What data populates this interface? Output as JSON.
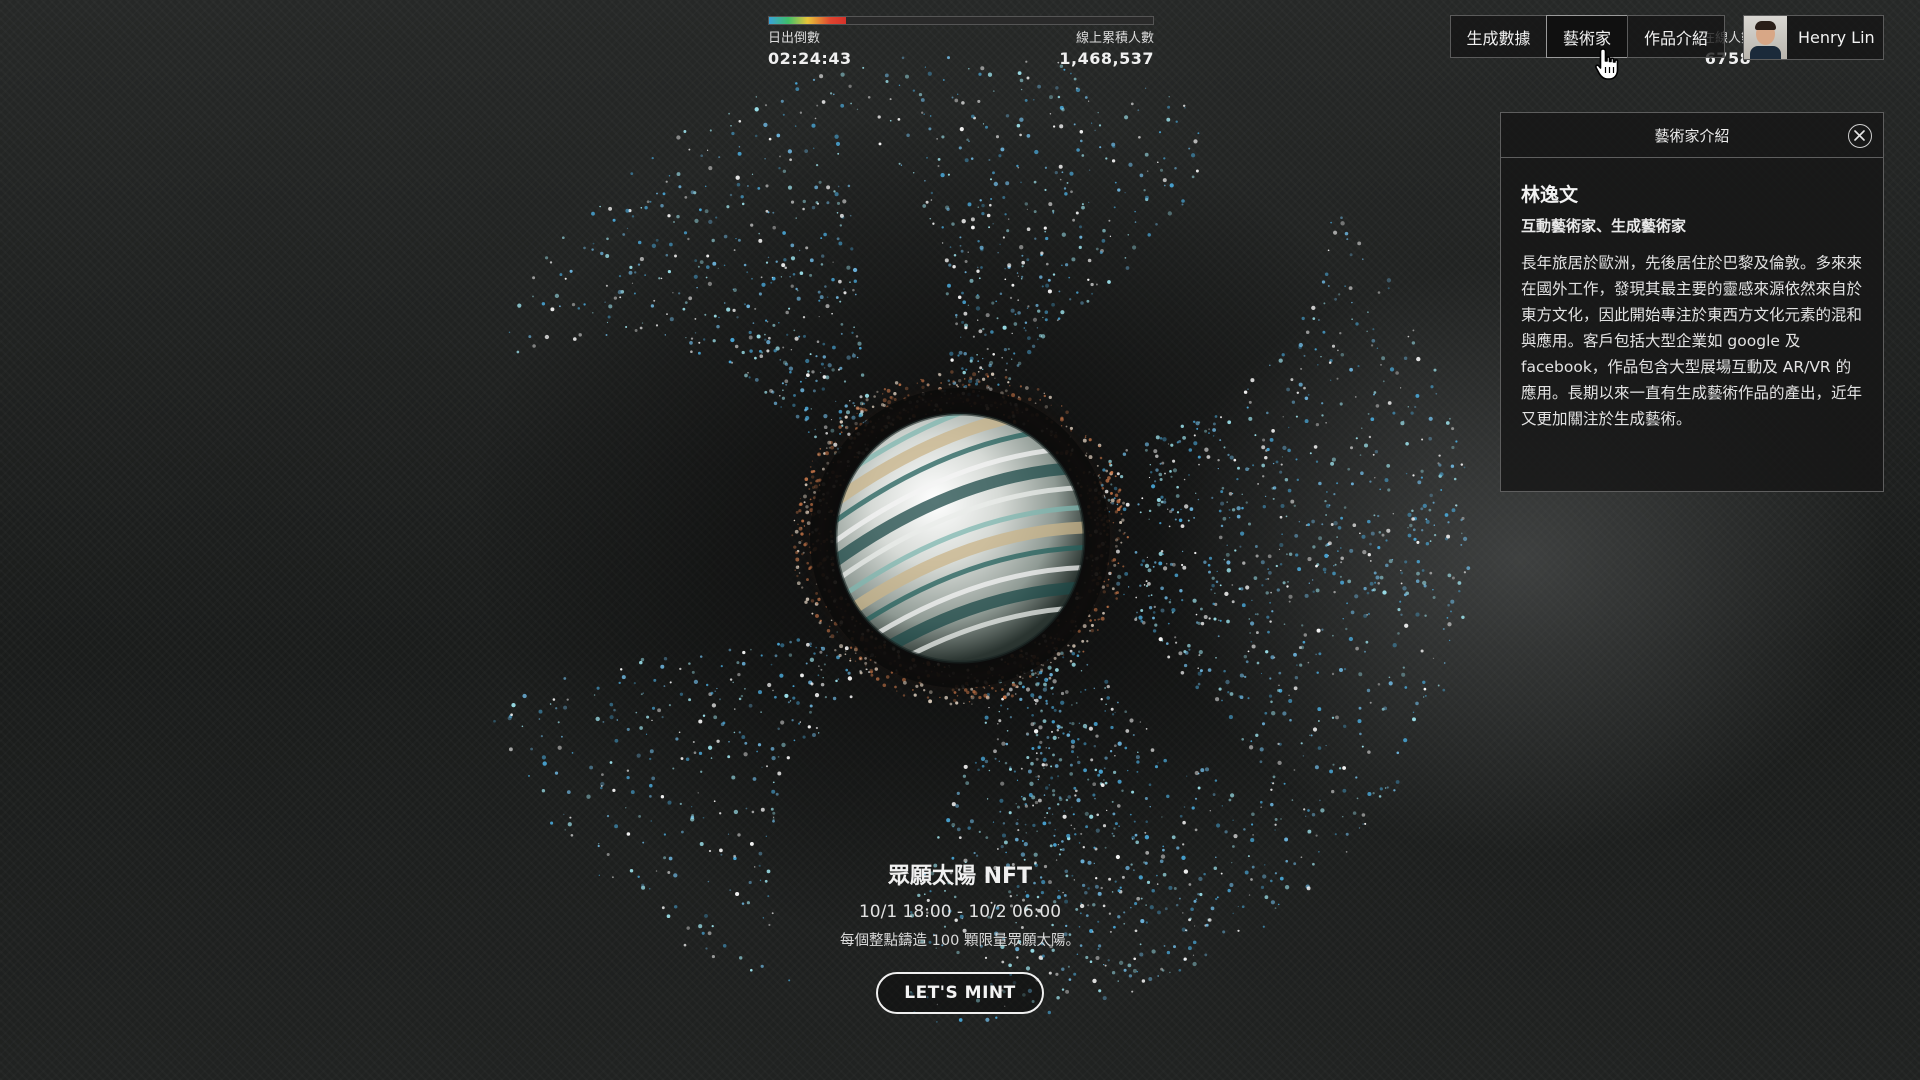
{
  "stats": {
    "progress": 0.2,
    "sunrise_label": "日出倒數",
    "sunrise_value": "02:24:43",
    "online_label": "在線人數",
    "online_value": "6758",
    "total_label": "線上累積人數",
    "total_value": "1,468,537"
  },
  "nav": {
    "items": [
      {
        "label": "生成數據"
      },
      {
        "label": "藝術家",
        "active": true
      },
      {
        "label": "作品介紹"
      }
    ],
    "user_name": "Henry Lin"
  },
  "panel": {
    "title": "藝術家介紹",
    "artist_name": "林逸文",
    "artist_role": "互動藝術家、生成藝術家",
    "bio": "長年旅居於歐洲，先後居住於巴黎及倫敦。多來來在國外工作，發現其最主要的靈感來源依然來自於東方文化，因此開始專注於東西方文化元素的混和與應用。客戶包括大型企業如 google 及 facebook，作品包含大型展場互動及 AR/VR 的應用。長期以來一直有生成藝術作品的產出，近年又更加關注於生成藝術。"
  },
  "hero": {
    "title": "眾願太陽 NFT",
    "date": "10/1 18:00 - 10/2 06:00",
    "desc": "每個整點鑄造 100 顆限量眾願太陽。",
    "mint_label": "LET'S MINT"
  },
  "colors": {
    "particle_blue": "#4aa8d8",
    "particle_cyan": "#9fe6f0",
    "particle_warm": "#c9784a"
  }
}
